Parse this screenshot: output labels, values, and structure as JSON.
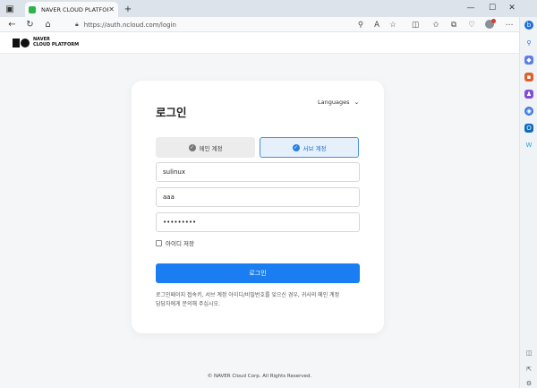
{
  "browser": {
    "tab_title": "NAVER CLOUD PLATFORM",
    "tab_close": "✕",
    "new_tab": "+",
    "url": "https://auth.ncloud.com/login",
    "win_minimize": "—",
    "win_maximize": "☐",
    "win_close": "✕"
  },
  "header": {
    "logo_line1": "NAVER",
    "logo_line2": "CLOUD PLATFORM"
  },
  "login": {
    "title": "로그인",
    "languages_label": "Languages",
    "main_account_tab": "메인 계정",
    "sub_account_tab": "서브 계정",
    "username_value": "sulinux",
    "subid_value": "aaa",
    "password_value": "•••••••••",
    "remember_label": "아이디 저장",
    "login_button": "로그인",
    "notice_line1": "로그인페이지 접속키, 서브 계정 아이디/비밀번호를 잊으신 경우, 귀사의 메인 계정",
    "notice_line2": "담당자에게 문의해 주십시오."
  },
  "footer": {
    "copyright": "© NAVER Cloud Corp. All Rights Reserved."
  },
  "colors": {
    "accent": "#1a7ef2",
    "sub_tab_bg": "#e5f0fb",
    "page_bg": "#f5f6f8"
  }
}
